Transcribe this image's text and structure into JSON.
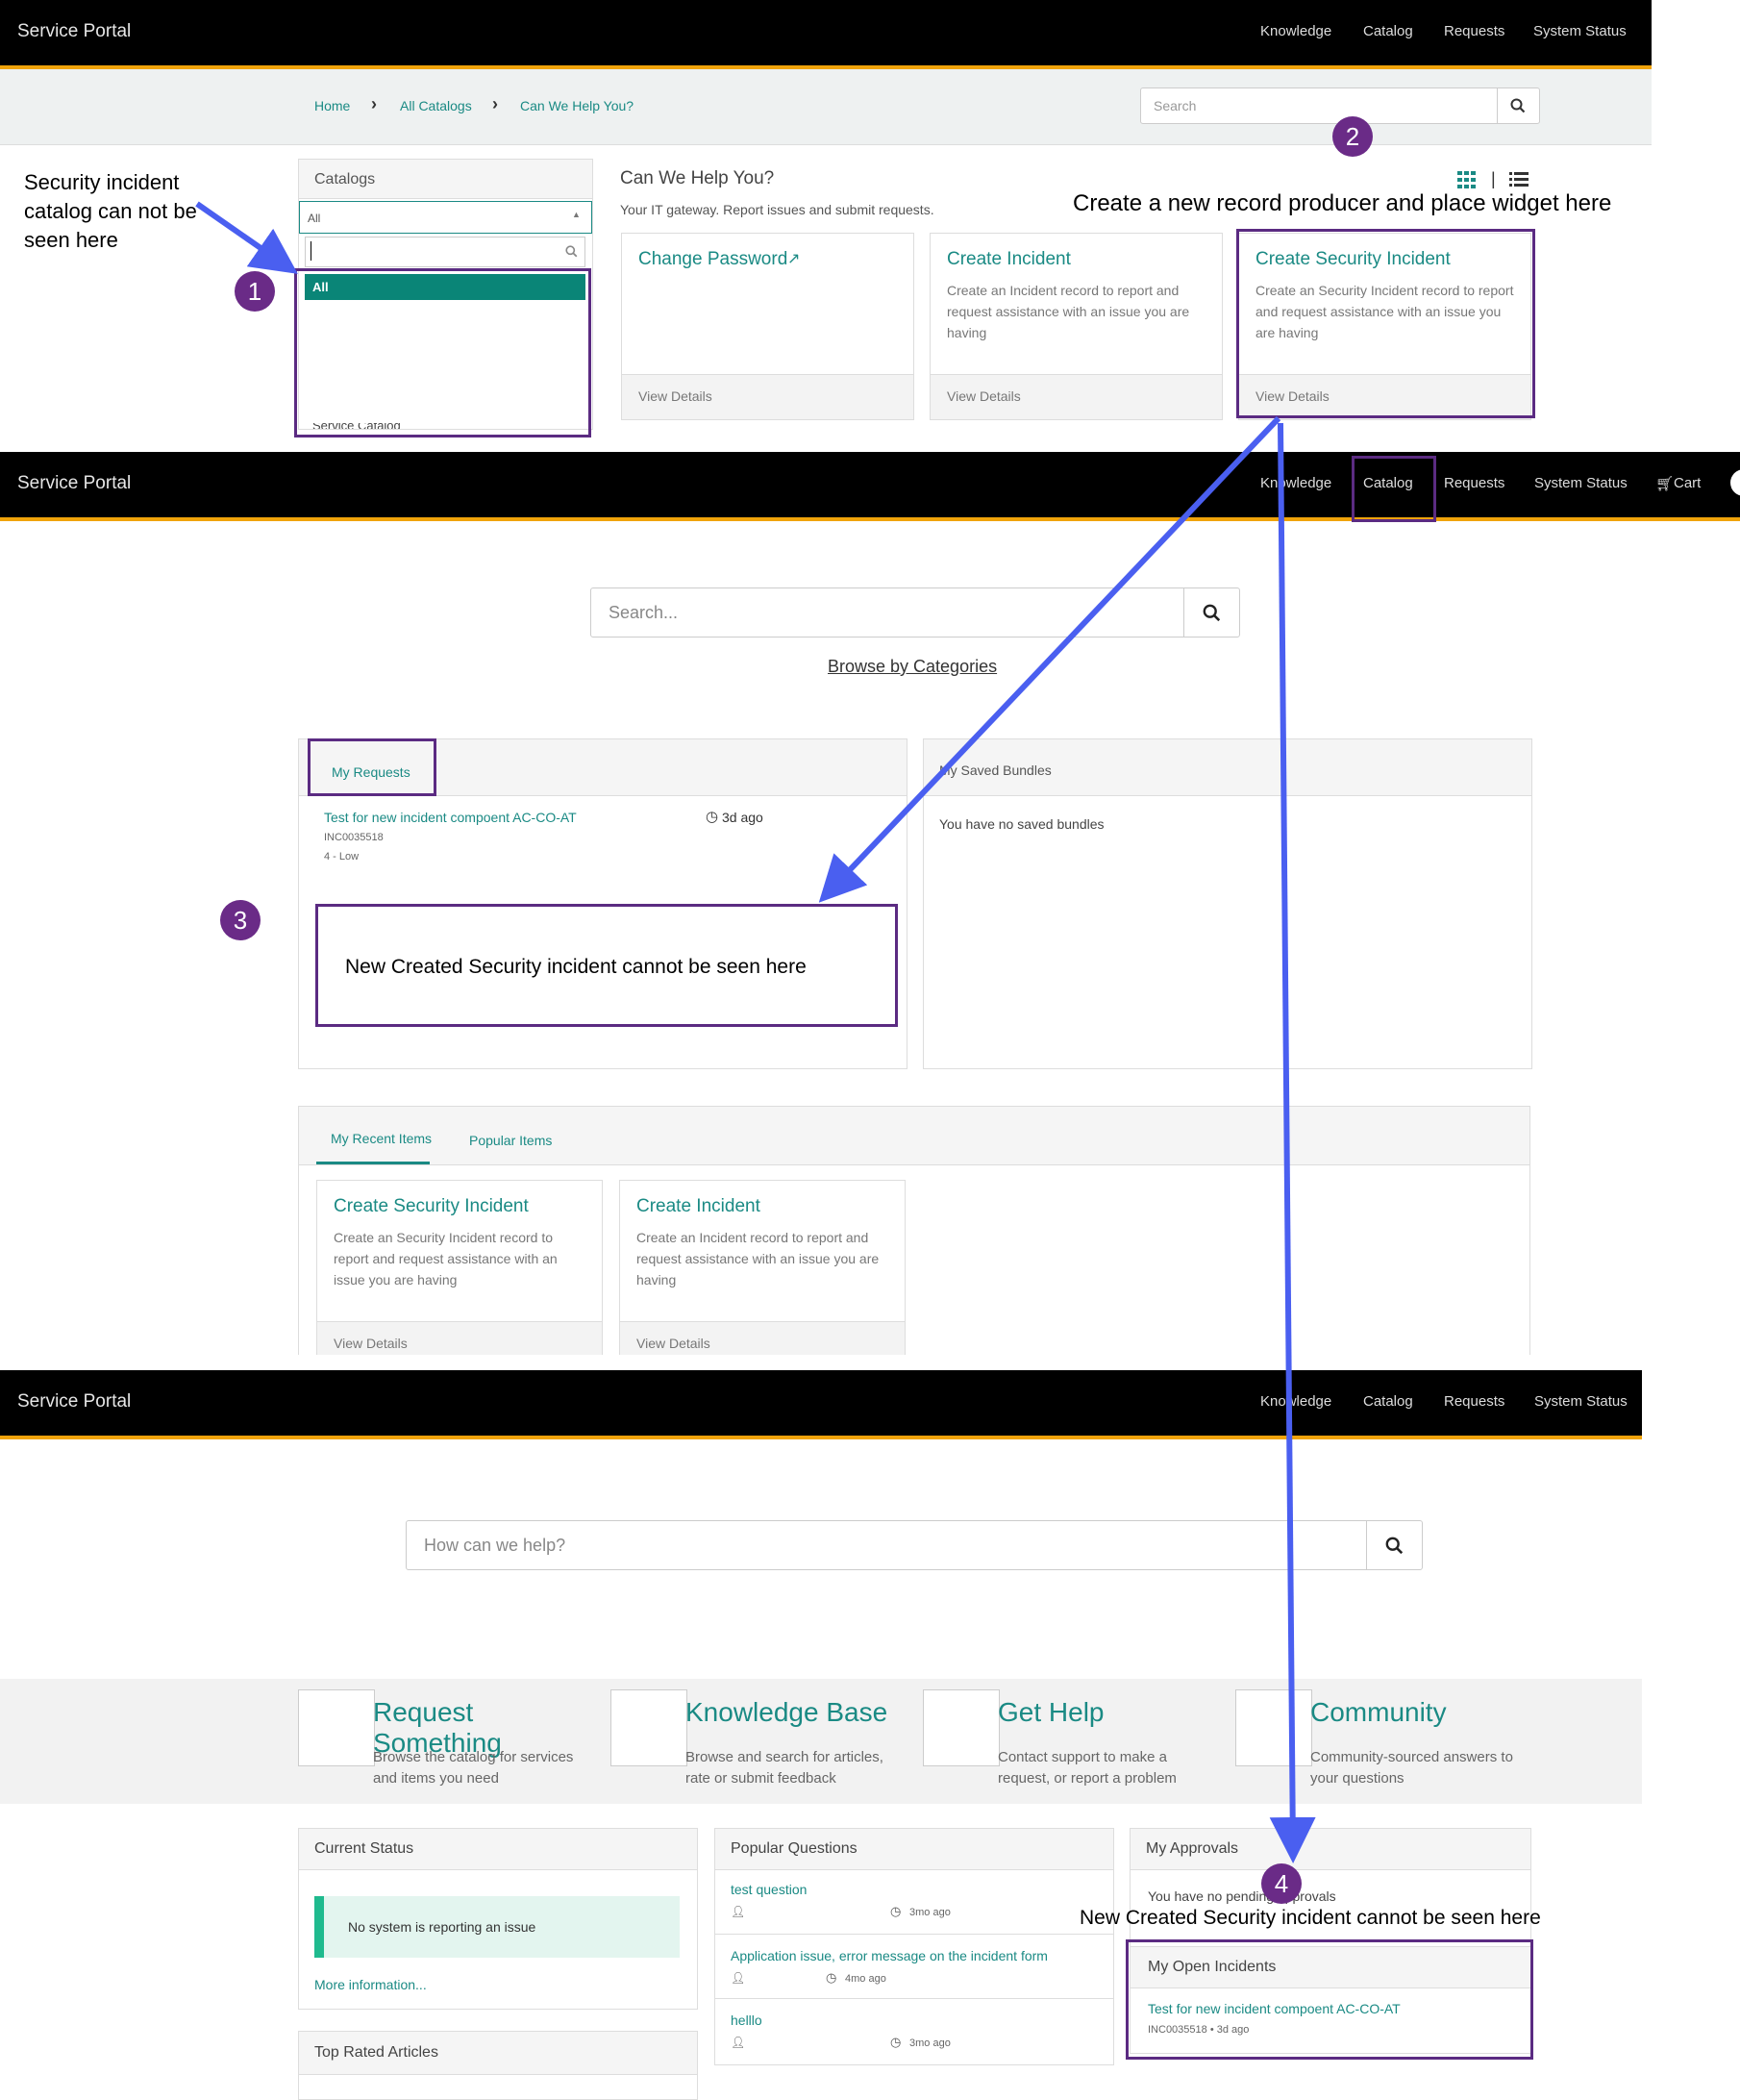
{
  "brand": "Service Portal",
  "section1": {
    "nav": [
      "Knowledge",
      "Catalog",
      "Requests",
      "System Status"
    ],
    "breadcrumbs": [
      "Home",
      "All Catalogs",
      "Can We Help You?"
    ],
    "search_placeholder": "Search",
    "catalogs_title": "Catalogs",
    "catalog_selected": "All",
    "dropdown_option": "All",
    "dropdown_partial": "Service Catalog",
    "page_title": "Can We Help You?",
    "page_subtitle": "Your IT gateway. Report issues and submit requests.",
    "cards": [
      {
        "title": "Change Password",
        "desc": "",
        "footer": "View Details"
      },
      {
        "title": "Create Incident",
        "desc": "Create an Incident record to report and request assistance with an issue you are having",
        "footer": "View Details"
      },
      {
        "title": "Create Security Incident",
        "desc": "Create an Security Incident record to report and request assistance with an issue you are having",
        "footer": "View Details"
      }
    ]
  },
  "section2": {
    "nav": [
      "Knowledge",
      "Catalog",
      "Requests",
      "System Status",
      "Cart"
    ],
    "search_placeholder": "Search...",
    "browse_link": "Browse by Categories",
    "my_requests": {
      "title": "My Requests",
      "item_title": "Test for new incident compoent AC-CO-AT",
      "item_number": "INC0035518",
      "item_priority": "4 - Low",
      "item_time": "3d ago"
    },
    "saved_bundles": {
      "title": "My Saved Bundles",
      "empty": "You have no saved bundles"
    },
    "tabs": [
      "My Recent Items",
      "Popular Items"
    ],
    "recent_cards": [
      {
        "title": "Create Security Incident",
        "desc": "Create an Security Incident record to report and request assistance with an issue you are having",
        "footer": "View Details"
      },
      {
        "title": "Create Incident",
        "desc": "Create an Incident record to report and request assistance with an issue you are having",
        "footer": "View Details"
      }
    ]
  },
  "section3": {
    "nav": [
      "Knowledge",
      "Catalog",
      "Requests",
      "System Status"
    ],
    "search_placeholder": "How can we help?",
    "tiles": [
      {
        "title": "Request Something",
        "desc": "Browse the catalog for services and items you need"
      },
      {
        "title": "Knowledge Base",
        "desc": "Browse and search for articles, rate or submit feedback"
      },
      {
        "title": "Get Help",
        "desc": "Contact support to make a request, or report a problem"
      },
      {
        "title": "Community",
        "desc": "Community-sourced answers to your questions"
      }
    ],
    "current_status": {
      "title": "Current Status",
      "message": "No system is reporting an issue",
      "more": "More information..."
    },
    "top_rated": {
      "title": "Top Rated Articles"
    },
    "popular_questions": {
      "title": "Popular Questions",
      "items": [
        {
          "q": "test question",
          "time": "3mo ago"
        },
        {
          "q": "Application issue, error message on the incident form",
          "time": "4mo ago"
        },
        {
          "q": "helllo",
          "time": "3mo ago"
        }
      ]
    },
    "my_approvals": {
      "title": "My Approvals",
      "empty": "You have no pending approvals"
    },
    "open_incidents": {
      "title": "My Open Incidents",
      "item_title": "Test for new incident compoent AC-CO-AT",
      "item_meta": "INC0035518 • 3d ago"
    }
  },
  "annotations": {
    "note1": "Security incident catalog can not be seen here",
    "note2": "Create a new record producer and place widget here",
    "note3": "New Created Security incident cannot be seen here",
    "note4": "New Created Security incident cannot be seen here",
    "markers": [
      "1",
      "2",
      "3",
      "4"
    ]
  },
  "colors": {
    "accent": "#1a8a84",
    "header": "#000000",
    "header_border": "#f0a30a",
    "annotation": "#5b2b82",
    "arrow": "#4a5ff0"
  }
}
